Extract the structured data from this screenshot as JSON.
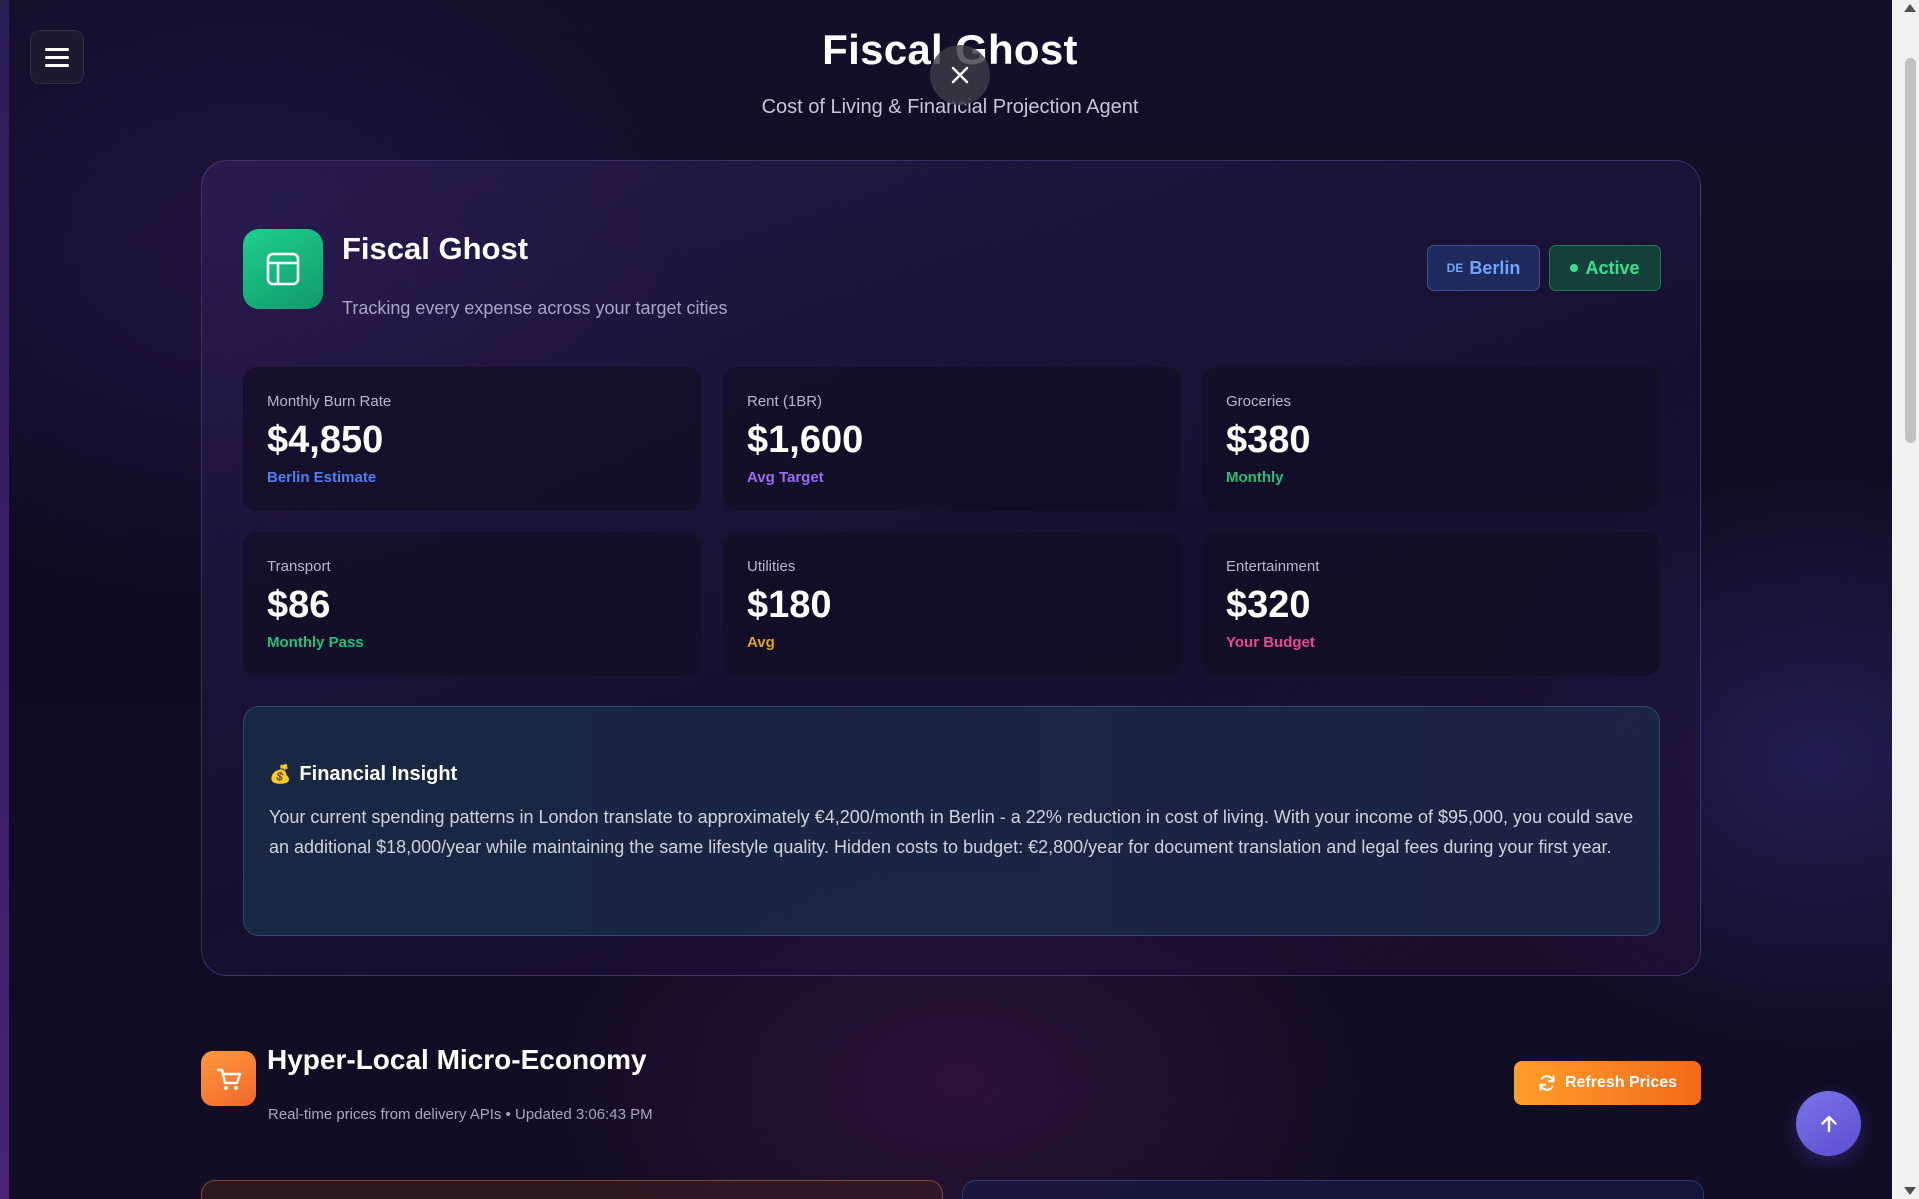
{
  "header": {
    "title": "Fiscal Ghost",
    "subtitle": "Cost of Living & Financial Projection Agent"
  },
  "agent_panel": {
    "title": "Fiscal Ghost",
    "description": "Tracking every expense across your target cities",
    "city_chip": {
      "flag": "DE",
      "label": "Berlin"
    },
    "status_chip": {
      "label": "Active"
    },
    "stats": [
      {
        "label": "Monthly Burn Rate",
        "value": "$4,850",
        "sub": "Berlin Estimate",
        "sub_color": "#4f7ff0"
      },
      {
        "label": "Rent (1BR)",
        "value": "$1,600",
        "sub": "Avg Target",
        "sub_color": "#9b6cf2"
      },
      {
        "label": "Groceries",
        "value": "$380",
        "sub": "Monthly",
        "sub_color": "#22c07a"
      },
      {
        "label": "Transport",
        "value": "$86",
        "sub": "Monthly Pass",
        "sub_color": "#22c07a"
      },
      {
        "label": "Utilities",
        "value": "$180",
        "sub": "Avg",
        "sub_color": "#e0a024"
      },
      {
        "label": "Entertainment",
        "value": "$320",
        "sub": "Your Budget",
        "sub_color": "#e84a8a"
      }
    ],
    "insight": {
      "emoji": "💰",
      "title": "Financial Insight",
      "body": "Your current spending patterns in London translate to approximately €4,200/month in Berlin - a 22% reduction in cost of living. With your income of $95,000, you could save an additional $18,000/year while maintaining the same lifestyle quality. Hidden costs to budget: €2,800/year for document translation and legal fees during your first year."
    }
  },
  "micro_economy": {
    "title": "Hyper-Local Micro-Economy",
    "subtitle": "Real-time prices from delivery APIs • Updated 3:06:43 PM",
    "refresh_label": "Refresh Prices"
  },
  "icons": {
    "menu": "hamburger-menu-icon",
    "close": "close-icon",
    "app": "layout-icon",
    "section": "shopping-cart-icon",
    "refresh": "refresh-icon",
    "scroll_top": "arrow-up-icon"
  }
}
